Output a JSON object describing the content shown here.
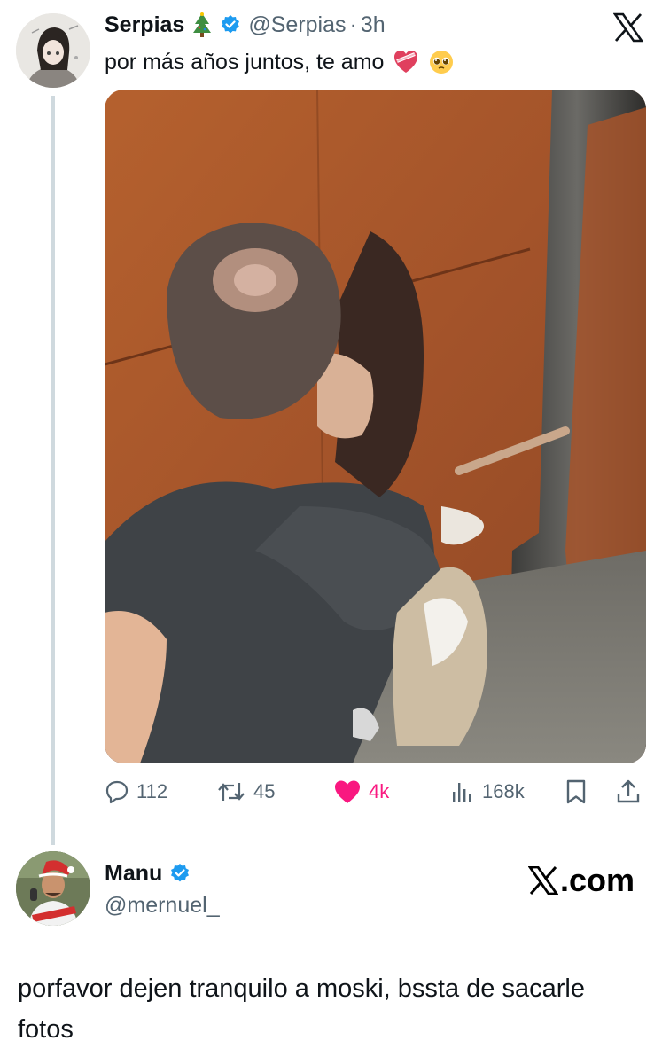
{
  "tweet": {
    "author_name": "Serpias",
    "author_handle": "@Serpias",
    "separator": "·",
    "time": "3h",
    "text": "por más años juntos, te amo",
    "avatar_icon": "anime-avatar-icon",
    "emoji_after_name": "christmas-tree-emoji",
    "emojis_after_text": [
      "heart-with-ribbon-emoji",
      "pleading-face-emoji"
    ],
    "verified": true,
    "accent_color": "#1d9bf0",
    "like_color": "#f91880",
    "stats": {
      "replies": "112",
      "reposts": "45",
      "likes": "4k",
      "views": "168k"
    }
  },
  "reply": {
    "author_name": "Manu",
    "author_handle": "@mernuel_",
    "verified": true,
    "avatar_icon": "user-avatar-icon",
    "text": "porfavor dejen tranquilo a moski, bssta de sacarle fotos"
  },
  "watermark": {
    "text": ".com",
    "icon": "x-logo-icon"
  }
}
